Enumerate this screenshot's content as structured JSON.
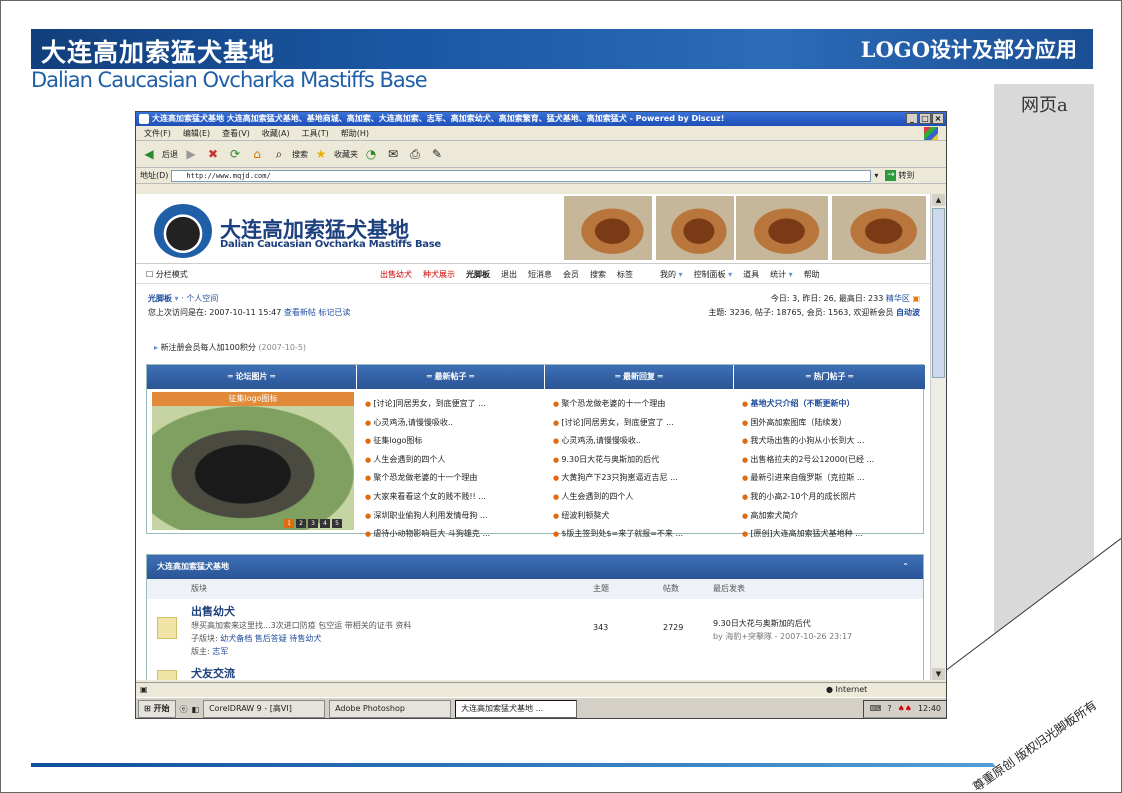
{
  "slide": {
    "brand_cn": "大连高加索猛犬基地",
    "brand_en": "Dalian Caucasian Ovcharka Mastiffs Base",
    "section_title": "LOGO设计及部分应用",
    "page_tag": "网页a",
    "copyright": "尊重原创 版权归光脚板所有"
  },
  "browser": {
    "title": "大连高加索猛犬基地 大连高加索猛犬基地、基地商城、高加索、大连高加索、志军、高加索幼犬、高加索繁育、猛犬基地、高加索猛犬 - Powered by Discuz!",
    "menu": [
      "文件(F)",
      "编辑(E)",
      "查看(V)",
      "收藏(A)",
      "工具(T)",
      "帮助(H)"
    ],
    "toolbar": {
      "back": "后退",
      "search": "搜索",
      "favorites": "收藏夹"
    },
    "address_label": "地址(D)",
    "url": "http://www.mqjd.com/",
    "go": "转到",
    "status_zone": "Internet"
  },
  "site": {
    "name": "大连高加索猛犬基地",
    "sub": "Dalian Caucasian Ovcharka Mastiffs Base",
    "cols_mode": "分栏模式",
    "nav": [
      "出售幼犬",
      "种犬展示",
      "光脚板",
      "退出",
      "短消息",
      "会员",
      "搜索",
      "标签"
    ],
    "nav_right": [
      "我的",
      "控制面板",
      "道具",
      "统计",
      "帮助"
    ],
    "user": "光脚板",
    "space": "个人空间",
    "last_visit": "您上次访问是在: 2007-10-11 15:47",
    "new_posts": "查看新帖",
    "mark_read": "标记已读",
    "stats1": "今日: 3, 昨日: 26, 最高日: 233",
    "elite": "精华区",
    "stats2": "主题: 3236, 帖子: 18765, 会员: 1563, 欢迎新会员",
    "newmember": "自动波",
    "notice": "新注册会员每人加100积分",
    "notice_date": "(2007-10-5)"
  },
  "boxes": {
    "pics_head": "═ 论坛图片 ═",
    "pic_label": "征集logo图标",
    "pager": [
      "1",
      "2",
      "3",
      "4",
      "5"
    ],
    "new_head": "═ 最新帖子 ═",
    "new_posts": [
      "[讨论]同居男女，到底便宜了 ...",
      "心灵鸡汤,请慢慢吸收..",
      "征集logo图标",
      "人生会遇到的四个人",
      "聚个恐龙做老婆的十一个理由",
      "大家来看看这个女的贱不贱!! ...",
      "深圳职业偷狗人利用发情母狗 ...",
      "虐待小动物影响巨大 斗狗雄克 ..."
    ],
    "reply_head": "═ 最新回复 ═",
    "replies": [
      "聚个恐龙做老婆的十一个理由",
      "[讨论]同居男女，到底便宜了 ...",
      "心灵鸡汤,请慢慢吸收..",
      "9.30日大花与奥斯加的后代",
      "大黄狗产下23只狗崽逼近吉尼 ...",
      "人生会遇到的四个人",
      "纽波利顿獒犬",
      "$版主签到处$=来了就报=不来 ..."
    ],
    "hot_head": "═ 热门帖子 ═",
    "hot": [
      "基地犬只介绍（不断更新中）",
      "国外高加索图库（陆续发）",
      "我犬场出售的小狗从小长到大 ...",
      "出售格拉夫的2号公12000(已经 ...",
      "最新引进来自俄罗斯（克拉斯 ...",
      "我的小高2-10个月的成长照片",
      "高加索犬简介",
      "[原创]大连高加索猛犬基地种 ..."
    ]
  },
  "forum": {
    "head": "大连高加索猛犬基地",
    "col_board": "版块",
    "col_topics": "主题",
    "col_posts": "帖数",
    "col_last": "最后发表",
    "rows": [
      {
        "title": "出售幼犬",
        "desc": "想买高加索来这里找...3次进口防疫 包空运 带相关的证书 资料",
        "sub_label": "子版块:",
        "subs": "幼犬备档  售后答疑  待售幼犬",
        "mod_label": "版主:",
        "mod": "志军",
        "topics": "343",
        "posts": "2729",
        "last_title": "9.30日大花与奥斯加的后代",
        "last_by": "by 海豹+突擊隊 - 2007-10-26 23:17"
      }
    ],
    "next_title": "犬友交流"
  },
  "taskbar": {
    "start": "开始",
    "tasks": [
      "CorelDRAW 9 - [高VI]",
      "Adobe Photoshop",
      "大连高加索猛犬基地 ..."
    ],
    "time": "12:40"
  },
  "colors": {
    "brand_blue": "#1c3f7e",
    "accent_orange": "#e06a10",
    "highlight_red": "#cc0000"
  }
}
